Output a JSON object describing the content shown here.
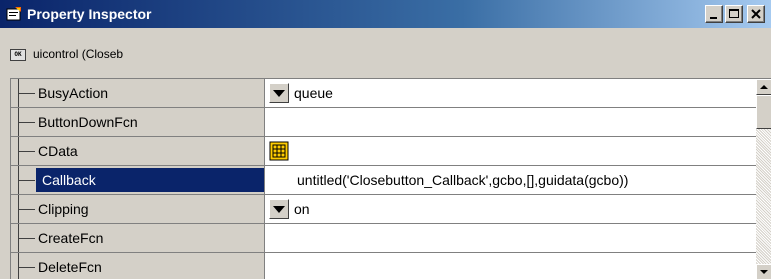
{
  "window": {
    "title": "Property Inspector",
    "controls": {
      "minimize_icon": "minimize-icon",
      "maximize_icon": "maximize-icon",
      "close_icon": "close-icon"
    }
  },
  "object_bar": {
    "icon": "uicontrol-icon",
    "icon_text": "OK",
    "label": "uicontrol (Closeb"
  },
  "properties": [
    {
      "name": "BusyAction",
      "value": "queue",
      "editor": "dropdown"
    },
    {
      "name": "ButtonDownFcn",
      "value": "",
      "editor": "text"
    },
    {
      "name": "CData",
      "value": "",
      "editor": "grid-button"
    },
    {
      "name": "Callback",
      "value": "untitled('Closebutton_Callback',gcbo,[],guidata(gcbo))",
      "editor": "text",
      "selected": true
    },
    {
      "name": "Clipping",
      "value": "on",
      "editor": "dropdown"
    },
    {
      "name": "CreateFcn",
      "value": "",
      "editor": "text"
    },
    {
      "name": "DeleteFcn",
      "value": "",
      "editor": "text"
    }
  ],
  "colors": {
    "title_gradient_start": "#0a246a",
    "selection": "#0a246a",
    "grid_icon": "#ffcc00"
  }
}
